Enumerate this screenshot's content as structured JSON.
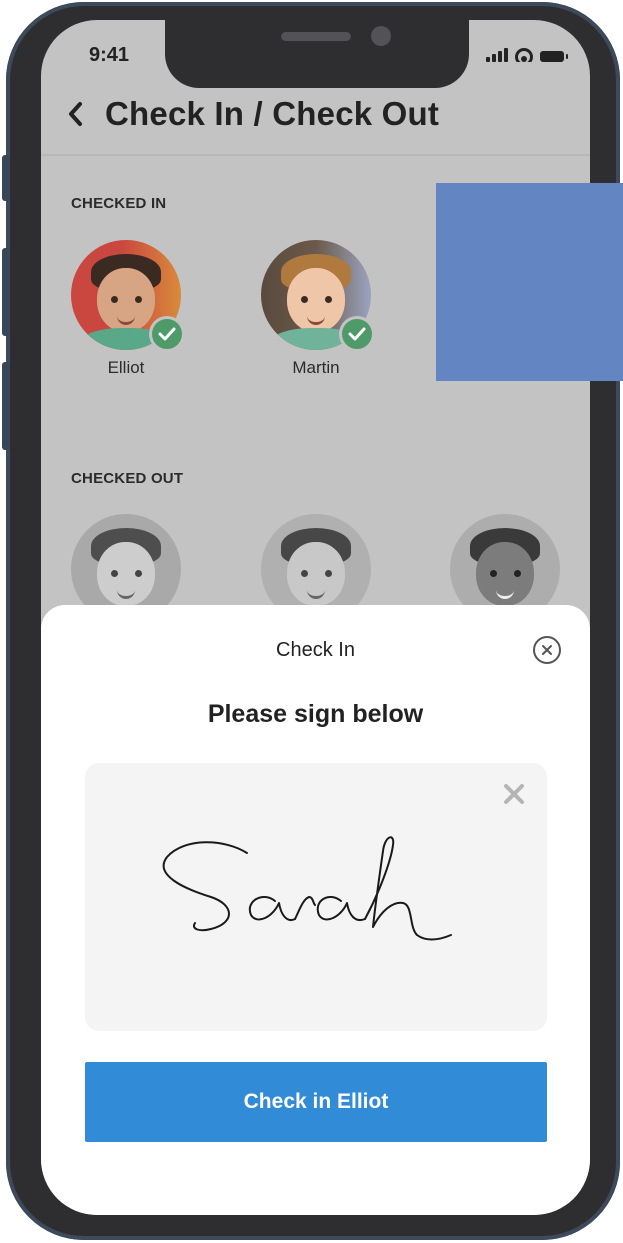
{
  "status_bar": {
    "time": "9:41"
  },
  "header": {
    "title": "Check In / Check Out"
  },
  "checked_in": {
    "label": "CHECKED IN",
    "children": [
      {
        "name": "Elliot"
      },
      {
        "name": "Martin"
      }
    ]
  },
  "checked_out": {
    "label": "CHECKED OUT"
  },
  "sheet": {
    "title": "Check In",
    "prompt": "Please sign below",
    "signature_text": "Sarah",
    "button_label": "Check in Elliot"
  },
  "colors": {
    "accent": "#318bd6",
    "check_badge": "#4f9a69",
    "overlay_block": "#6386c3"
  }
}
